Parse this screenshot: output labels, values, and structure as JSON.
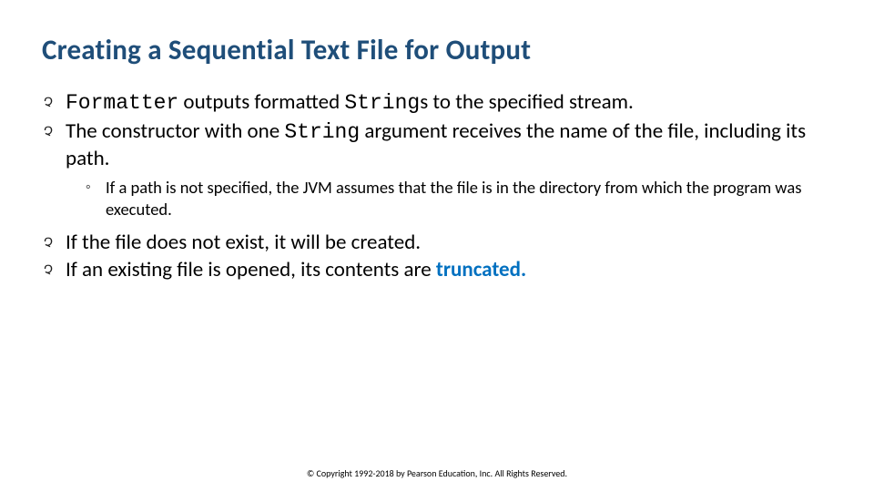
{
  "title": "Creating a Sequential Text File for Output",
  "b1": {
    "t1": "Formatter",
    "t2": " outputs formatted ",
    "t3": "String",
    "t4": "s to the specified stream."
  },
  "b2": {
    "t1": "The constructor with one ",
    "t2": "String",
    "t3": " argument receives the name of the file, including its path."
  },
  "s1": "If a path is not specified, the JVM assumes that the file is in the directory from which the program was executed.",
  "b3": "If the file does not exist, it will be created.",
  "b4": {
    "t1": "If an existing file is opened, its contents are ",
    "t2": "truncated.",
    "t3": ""
  },
  "bullet_glyph": "Չ",
  "sub_glyph": "◦",
  "copyright": "© Copyright 1992-2018 by Pearson Education, Inc. All Rights Reserved."
}
